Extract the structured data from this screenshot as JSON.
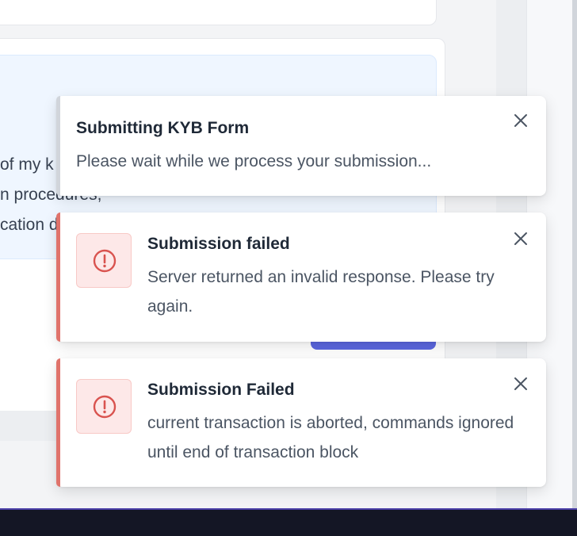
{
  "background": {
    "info_lines": [
      "of my k",
      "n procedures,",
      "cation d"
    ]
  },
  "toasts": [
    {
      "type": "info",
      "title": "Submitting KYB Form",
      "message": "Please wait while we process your submission...",
      "close_icon": "close-icon"
    },
    {
      "type": "error",
      "title": "Submission failed",
      "message": "Server returned an invalid response. Please try again.",
      "icon": "alert-circle-icon",
      "close_icon": "close-icon"
    },
    {
      "type": "error",
      "title": "Submission Failed",
      "message": "current transaction is aborted, commands ignored until end of transaction block",
      "icon": "alert-circle-icon",
      "close_icon": "close-icon"
    }
  ],
  "colors": {
    "error_accent": "#e0736b",
    "error_icon": "#d9534f",
    "error_icon_bg": "#fde8e8",
    "info_accent": "#d1d5db",
    "primary_button": "#5b67e0"
  }
}
